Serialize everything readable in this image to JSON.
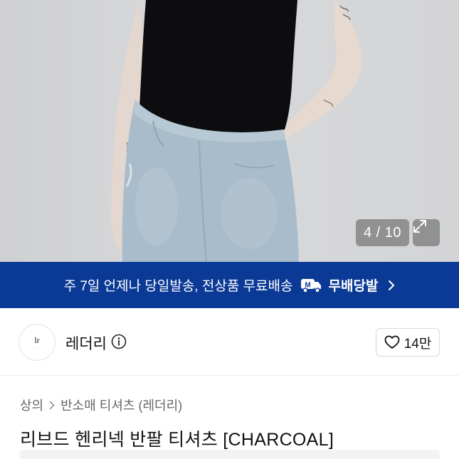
{
  "gallery": {
    "counter_text": "4 / 10",
    "expand_icon": "expand-icon"
  },
  "banner": {
    "text": "주 7일 언제나 당일발송, 전상품 무료배송",
    "badge_label": "무배당발",
    "badge_icon": "truck-m-icon",
    "color": "#0b3a96"
  },
  "brand": {
    "name": "레더리",
    "logo_text": "lr",
    "like_count": "14만"
  },
  "breadcrumb": {
    "items": [
      "상의",
      "반소매 티셔츠 (레더리)"
    ]
  },
  "product": {
    "title": "리브드 헨리넥 반팔 티셔츠 [CHARCOAL]"
  }
}
